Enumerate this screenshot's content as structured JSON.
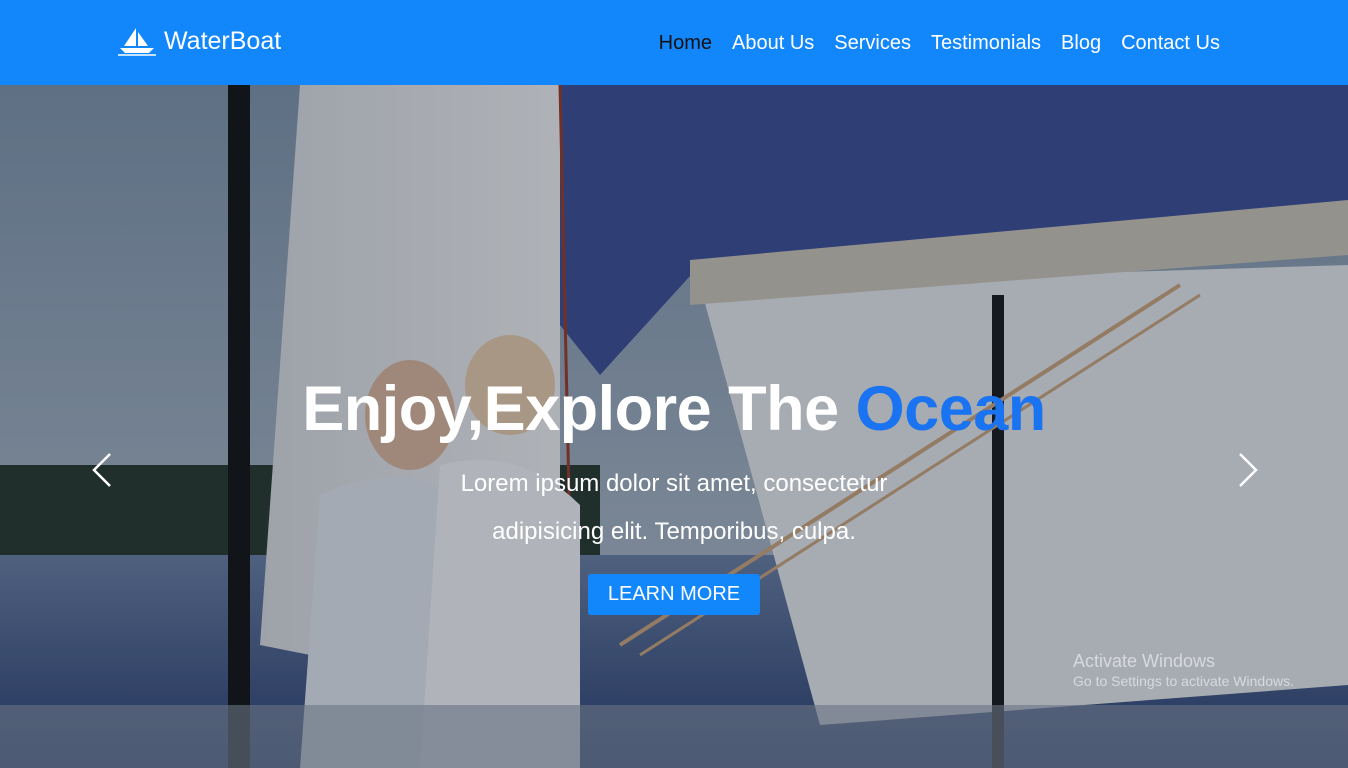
{
  "brand": {
    "name": "WaterBoat",
    "icon": "sailboat-icon"
  },
  "nav": {
    "items": [
      {
        "label": "Home",
        "active": true
      },
      {
        "label": "About Us"
      },
      {
        "label": "Services"
      },
      {
        "label": "Testimonials"
      },
      {
        "label": "Blog"
      },
      {
        "label": "Contact Us"
      }
    ]
  },
  "hero": {
    "title_main": "Enjoy,Explore The ",
    "title_accent": "Ocean",
    "subtitle": "Lorem ipsum dolor sit amet, consectetur adipisicing elit. Temporibus, culpa.",
    "cta_label": "LEARN MORE",
    "prev_icon": "chevron-left-icon",
    "next_icon": "chevron-right-icon"
  },
  "watermark": {
    "line1": "Activate Windows",
    "line2": "Go to Settings to activate Windows."
  },
  "colors": {
    "primary": "#1287fb",
    "accent": "#1a73f0",
    "active_nav": "#111111"
  }
}
